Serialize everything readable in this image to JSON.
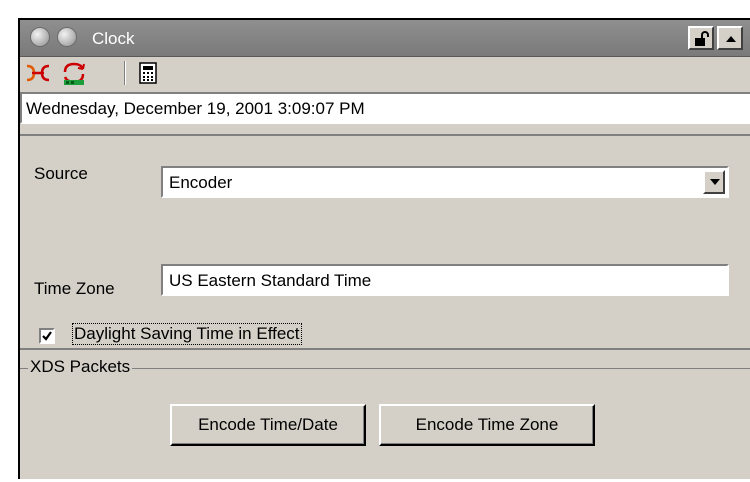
{
  "window": {
    "title": "Clock"
  },
  "titlebar_buttons": {
    "lock_icon": "unlock-icon",
    "collapse_icon": "triangle-up-icon"
  },
  "toolbar": {
    "items": [
      {
        "icon": "encoder-connect-icon"
      },
      {
        "icon": "sync-clock-icon"
      },
      {
        "icon": "calculator-icon"
      }
    ]
  },
  "datetime": {
    "value": "Wednesday, December 19, 2001 3:09:07 PM"
  },
  "settings": {
    "source_label": "Source",
    "source_value": "Encoder",
    "timezone_label": "Time Zone",
    "timezone_value": "US Eastern Standard Time",
    "dst_label": "Daylight Saving Time in Effect",
    "dst_checked": true
  },
  "xds": {
    "group_label": "XDS Packets",
    "encode_time_date": "Encode Time/Date",
    "encode_time_zone": "Encode Time Zone"
  }
}
